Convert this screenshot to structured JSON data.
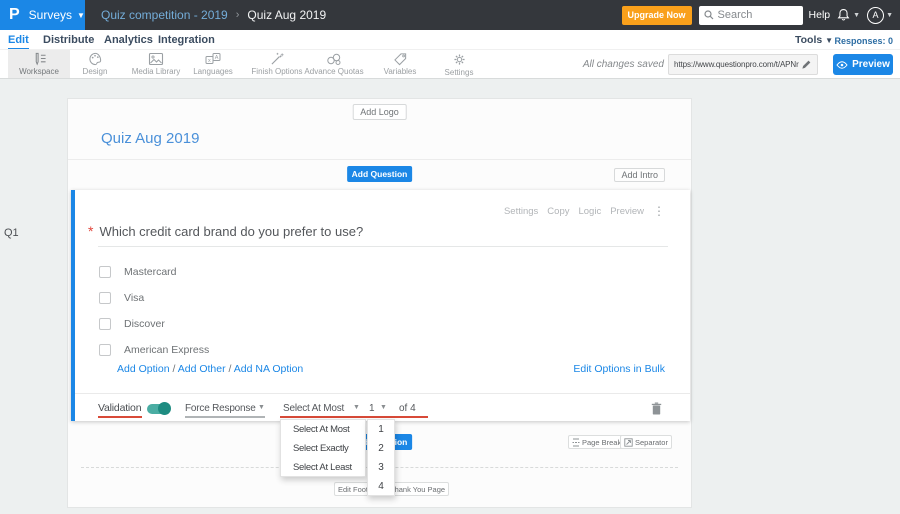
{
  "topbar": {
    "logo": "P",
    "product_menu": "Surveys",
    "breadcrumb": {
      "survey": "Quiz competition - 2019",
      "separator": "›",
      "page": "Quiz Aug 2019"
    },
    "upgrade_label": "Upgrade Now",
    "search_placeholder": "Search",
    "help_label": "Help",
    "avatar_initial": "A"
  },
  "nav": {
    "tabs": [
      "Edit",
      "Distribute",
      "Analytics",
      "Integration"
    ],
    "active_tab": "Edit",
    "tools_label": "Tools",
    "responses_label": "Responses: 0"
  },
  "toolbar": {
    "items": [
      "Workspace",
      "Design",
      "Media Library",
      "Languages",
      "Finish Options",
      "Advance Quotas",
      "Variables",
      "Settings"
    ],
    "active_item": "Workspace",
    "status": "All changes saved",
    "url": "https://www.questionpro.com/t/APNrFZ",
    "preview_label": "Preview"
  },
  "survey": {
    "question_number": "Q1",
    "add_logo_label": "Add Logo",
    "title": "Quiz Aug 2019",
    "add_question_label": "Add Question",
    "add_intro_label": "Add Intro"
  },
  "question": {
    "actions": [
      "Settings",
      "Copy",
      "Logic",
      "Preview"
    ],
    "menu_dots": "⋮",
    "required_mark": "*",
    "text": "Which credit card brand do you prefer to use?",
    "options": [
      "Mastercard",
      "Visa",
      "Discover",
      "American Express"
    ],
    "links": [
      "Add Option",
      "Add Other",
      "Add NA Option"
    ],
    "link_separator": "/",
    "bulk_link": "Edit Options in Bulk"
  },
  "validation": {
    "label": "Validation",
    "toggle_on": true,
    "force_response_label": "Force Response",
    "rule_value": "Select At Most",
    "count_value": "1",
    "of_label": "of 4"
  },
  "dropdowns": {
    "rules": [
      "Select At Most",
      "Select Exactly",
      "Select At Least"
    ],
    "counts": [
      "1",
      "2",
      "3",
      "4"
    ]
  },
  "footer": {
    "add_question_label": "Add Question",
    "page_break_label": "Page Break",
    "separator_label": "Separator",
    "edit_footer_label": "Edit Footer",
    "thank_you_label": "Thank You Page"
  }
}
